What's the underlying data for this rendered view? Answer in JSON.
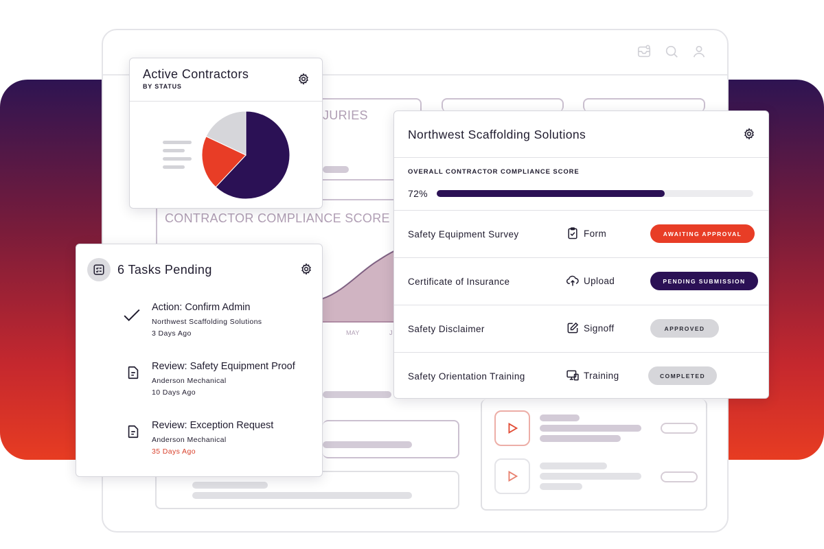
{
  "colors": {
    "brand_purple": "#2b1155",
    "brand_red": "#e83d26",
    "neutral_gray": "#d6d6da"
  },
  "background_app": {
    "header_icons": [
      "inbox-icon",
      "search-icon",
      "user-icon"
    ],
    "ghost_labels": {
      "injuries": "JURIES",
      "compliance_score": "CONTRACTOR COMPLIANCE SCORE",
      "month_may": "MAY",
      "month_j": "J"
    }
  },
  "active_contractors": {
    "title": "Active Contractors",
    "subtitle": "BY STATUS",
    "pie_slices": [
      {
        "value": 0.62,
        "color": "#2b1155"
      },
      {
        "value": 0.2,
        "color": "#e83d26"
      },
      {
        "value": 0.18,
        "color": "#d6d6da"
      }
    ]
  },
  "tasks": {
    "title": "6 Tasks Pending",
    "items": [
      {
        "title": "Action: Confirm Admin",
        "company": "Northwest Scaffolding Solutions",
        "age": "3 Days Ago",
        "icon": "check-icon"
      },
      {
        "title": "Review: Safety Equipment Proof",
        "company": "Anderson Mechanical",
        "age": "10 Days Ago",
        "icon": "document-icon"
      },
      {
        "title": "Review: Exception Request",
        "company": "Anderson Mechanical",
        "age": "35 Days Ago",
        "icon": "document-icon"
      }
    ]
  },
  "contractor": {
    "title": "Northwest Scaffolding Solutions",
    "score_label": "OVERALL CONTRACTOR COMPLIANCE SCORE",
    "score_text": "72%",
    "score_value": 0.72,
    "requirements": [
      {
        "name": "Safety Equipment Survey",
        "type": "Form",
        "status": "AWAITING APPROVAL",
        "icon": "clipboard-check-icon"
      },
      {
        "name": "Certificate of Insurance",
        "type": "Upload",
        "status": "PENDING SUBMISSION",
        "icon": "upload-cloud-icon"
      },
      {
        "name": "Safety Disclaimer",
        "type": "Signoff",
        "status": "APPROVED",
        "icon": "sign-pen-icon"
      },
      {
        "name": "Safety Orientation Training",
        "type": "Training",
        "status": "COMPLETED",
        "icon": "training-screen-icon"
      }
    ]
  }
}
